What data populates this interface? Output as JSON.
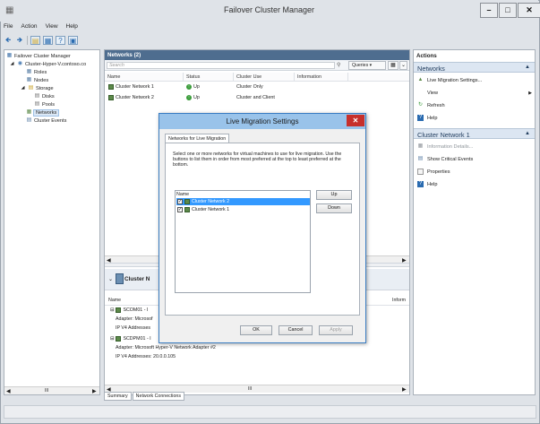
{
  "window": {
    "title": "Failover Cluster Manager"
  },
  "menu": [
    "File",
    "Action",
    "View",
    "Help"
  ],
  "tree": {
    "items": [
      {
        "label": "Failover Cluster Manager",
        "level": 0
      },
      {
        "label": "Cluster-Hyper-V.contoso.co",
        "level": 1
      },
      {
        "label": "Roles",
        "level": 2
      },
      {
        "label": "Nodes",
        "level": 2
      },
      {
        "label": "Storage",
        "level": 2
      },
      {
        "label": "Disks",
        "level": 3
      },
      {
        "label": "Pools",
        "level": 3
      },
      {
        "label": "Networks",
        "level": 2
      },
      {
        "label": "Cluster Events",
        "level": 2
      }
    ],
    "hscroll_label": "III"
  },
  "center": {
    "title": "Networks (2)",
    "search_placeholder": "Search",
    "queries_label": "Queries",
    "columns": [
      "Name",
      "Status",
      "Cluster Use",
      "Information"
    ],
    "rows": [
      {
        "name": "Cluster Network 1",
        "status": "Up",
        "use": "Cluster Only",
        "info": ""
      },
      {
        "name": "Cluster Network 2",
        "status": "Up",
        "use": "Cluster and Client",
        "info": ""
      }
    ],
    "detail": {
      "title": "Cluster N",
      "name_col": "Name",
      "info_col": "Inform",
      "lines": [
        "SCOM01 - I",
        "Adapter: Microsof",
        "IP V4 Addresses",
        "SCDPM01 - I",
        "Adapter: Microsoft Hyper-V Network Adapter #2",
        "IP V4 Addresses: 20.0.0.105"
      ],
      "hscroll_label": "III"
    },
    "tabs": [
      "Summary",
      "Network Connections"
    ]
  },
  "actions": {
    "title": "Actions",
    "sections": [
      {
        "title": "Networks",
        "items": [
          {
            "label": "Live Migration Settings...",
            "icon": "network-settings-icon",
            "disabled": false
          },
          {
            "label": "View",
            "icon": "",
            "disabled": false,
            "submenu": true
          },
          {
            "label": "Refresh",
            "icon": "refresh-icon",
            "disabled": false
          },
          {
            "label": "Help",
            "icon": "help-icon",
            "disabled": false
          }
        ]
      },
      {
        "title": "Cluster Network 1",
        "items": [
          {
            "label": "Information Details...",
            "icon": "info-icon",
            "disabled": true
          },
          {
            "label": "Show Critical Events",
            "icon": "events-icon",
            "disabled": false
          },
          {
            "label": "Properties",
            "icon": "properties-icon",
            "disabled": false
          },
          {
            "label": "Help",
            "icon": "help-icon",
            "disabled": false
          }
        ]
      }
    ]
  },
  "dialog": {
    "title": "Live Migration Settings",
    "tab": "Networks for Live Migration",
    "description": "Select one or more networks for virtual machines to use for live migration. Use the buttons to list them in order from most preferred at the top to least preferred at the bottom.",
    "list_header": "Name",
    "networks": [
      {
        "label": "Cluster Network 2",
        "checked": true,
        "selected": true
      },
      {
        "label": "Cluster Network 1",
        "checked": true,
        "selected": false
      }
    ],
    "up_label": "Up",
    "down_label": "Down",
    "ok_label": "OK",
    "cancel_label": "Cancel",
    "apply_label": "Apply"
  }
}
